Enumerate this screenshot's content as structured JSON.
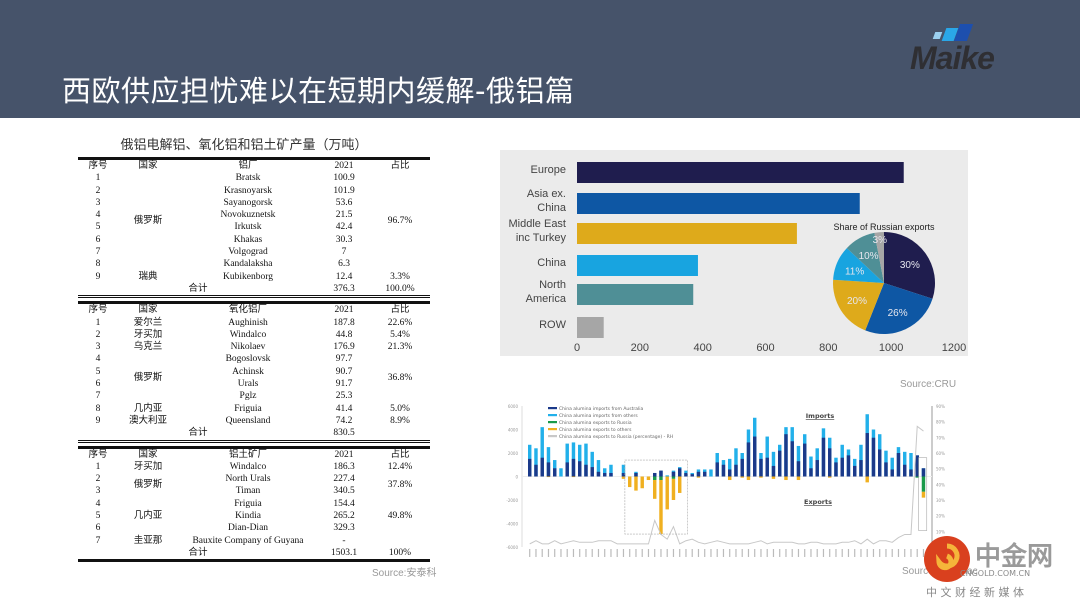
{
  "header": {
    "title": "西欧供应担忧难以在短期内缓解-俄铝篇",
    "logo_text": "Maike"
  },
  "tables": {
    "caption": "俄铝电解铝、氧化铝和铝土矿产量（万吨）",
    "source": "Source:安泰科",
    "sections": [
      {
        "headers": [
          "序号",
          "国家",
          "铝厂",
          "2021",
          "占比"
        ],
        "groups": [
          {
            "country": "俄罗斯",
            "share": "96.7%",
            "rows": [
              [
                "1",
                "Bratsk",
                "100.9"
              ],
              [
                "2",
                "Krasnoyarsk",
                "101.9"
              ],
              [
                "3",
                "Sayanogorsk",
                "53.6"
              ],
              [
                "4",
                "Novokuznetsk",
                "21.5"
              ],
              [
                "5",
                "Irkutsk",
                "42.4"
              ],
              [
                "6",
                "Khakas",
                "30.3"
              ],
              [
                "7",
                "Volgograd",
                "7"
              ],
              [
                "8",
                "Kandalaksha",
                "6.3"
              ]
            ]
          },
          {
            "country": "瑞典",
            "share": "3.3%",
            "rows": [
              [
                "9",
                "Kubikenborg",
                "12.4"
              ]
            ]
          }
        ],
        "total": {
          "label": "合计",
          "value": "376.3",
          "share": "100.0%"
        }
      },
      {
        "headers": [
          "序号",
          "国家",
          "氧化铝厂",
          "2021",
          "占比"
        ],
        "groups": [
          {
            "country": "爱尔兰",
            "share": "22.6%",
            "rows": [
              [
                "1",
                "Aughinish",
                "187.8"
              ]
            ]
          },
          {
            "country": "牙买加",
            "share": "5.4%",
            "rows": [
              [
                "2",
                "Windalco",
                "44.8"
              ]
            ]
          },
          {
            "country": "乌克兰",
            "share": "21.3%",
            "rows": [
              [
                "3",
                "Nikolaev",
                "176.9"
              ]
            ]
          },
          {
            "country": "俄罗斯",
            "share": "36.8%",
            "rows": [
              [
                "4",
                "Bogoslovsk",
                "97.7"
              ],
              [
                "5",
                "Achinsk",
                "90.7"
              ],
              [
                "6",
                "Urals",
                "91.7"
              ],
              [
                "7",
                "Pglz",
                "25.3"
              ]
            ]
          },
          {
            "country": "几内亚",
            "share": "5.0%",
            "rows": [
              [
                "8",
                "Friguia",
                "41.4"
              ]
            ]
          },
          {
            "country": "澳大利亚",
            "share": "8.9%",
            "rows": [
              [
                "9",
                "Queensland",
                "74.2"
              ]
            ]
          }
        ],
        "total": {
          "label": "合计",
          "value": "830.5",
          "share": ""
        }
      },
      {
        "headers": [
          "序号",
          "国家",
          "铝土矿厂",
          "2021",
          "占比"
        ],
        "groups": [
          {
            "country": "牙买加",
            "share": "12.4%",
            "rows": [
              [
                "1",
                "Windalco",
                "186.3"
              ]
            ]
          },
          {
            "country": "俄罗斯",
            "share": "37.8%",
            "rows": [
              [
                "2",
                "North Urals",
                "227.4"
              ],
              [
                "3",
                "Timan",
                "340.5"
              ]
            ]
          },
          {
            "country": "几内亚",
            "share": "49.8%",
            "rows": [
              [
                "4",
                "Friguia",
                "154.4"
              ],
              [
                "5",
                "Kindia",
                "265.2"
              ],
              [
                "6",
                "Dian-Dian",
                "329.3"
              ]
            ]
          },
          {
            "country": "圭亚那",
            "share": "",
            "rows": [
              [
                "7",
                "Bauxite Company of Guyana",
                "-"
              ]
            ]
          }
        ],
        "total": {
          "label": "合计",
          "value": "1503.1",
          "share": "100%"
        }
      }
    ]
  },
  "chart_data": [
    {
      "type": "bar",
      "orientation": "horizontal",
      "categories": [
        "Europe",
        "Asia ex. China",
        "Middle East inc Turkey",
        "China",
        "North America",
        "ROW"
      ],
      "values": [
        1040,
        900,
        700,
        385,
        370,
        85
      ],
      "colors": [
        "#1f1d4e",
        "#0e57a4",
        "#deaa1b",
        "#18a4e0",
        "#4f8f96",
        "#a6a6a6"
      ],
      "xlim": [
        0,
        1200
      ],
      "xticks": [
        0,
        200,
        400,
        600,
        800,
        1000,
        1200
      ],
      "source": "Source:CRU",
      "inset": {
        "type": "pie",
        "title": "Share of Russian exports",
        "labels": [
          "30%",
          "26%",
          "20%",
          "11%",
          "10%",
          "3%"
        ],
        "values": [
          30,
          26,
          20,
          11,
          10,
          3
        ]
      }
    },
    {
      "type": "bar",
      "stacked": true,
      "legend": [
        "China alumina imports from Australia",
        "China alumina imports from others",
        "China alumina exports to Russia",
        "China alumina exports to others",
        "China alumina exports to Russia (percentage) - RH"
      ],
      "colors": [
        "#1b3a8a",
        "#22b0ea",
        "#1a9a4a",
        "#f0b020",
        "#c8c8c8"
      ],
      "annotations": [
        "Imports",
        "Exports"
      ],
      "ylim": [
        -6000,
        6000
      ],
      "yticks": [
        "6000",
        "4000",
        "2000",
        "0",
        "-2000",
        "-4000",
        "-6000"
      ],
      "y2lim": [
        0,
        90
      ],
      "y2ticks": [
        "90%",
        "80%",
        "70%",
        "60%",
        "50%",
        "40%",
        "30%",
        "20%",
        "10%"
      ],
      "au": [
        1500,
        1000,
        1600,
        1200,
        700,
        0,
        1200,
        1500,
        1300,
        1000,
        800,
        400,
        300,
        300,
        0,
        300,
        0,
        300,
        0,
        0,
        300,
        500,
        0,
        400,
        700,
        300,
        200,
        400,
        400,
        0,
        1200,
        1000,
        600,
        1000,
        1500,
        2900,
        3400,
        1500,
        1600,
        900,
        2200,
        3600,
        3000,
        1300,
        2800,
        700,
        1400,
        3300,
        2400,
        1200,
        1600,
        1800,
        900,
        1400,
        3700,
        3300,
        2300,
        1200,
        600,
        2000,
        1000,
        600,
        1800,
        700
      ],
      "total_imports": [
        2700,
        2400,
        4200,
        2500,
        1400,
        700,
        2800,
        2900,
        2700,
        2800,
        2100,
        1400,
        700,
        1000,
        0,
        1000,
        0,
        400,
        0,
        0,
        300,
        500,
        100,
        500,
        800,
        500,
        300,
        600,
        600,
        600,
        2000,
        1400,
        1500,
        2400,
        2000,
        4000,
        5000,
        2000,
        3400,
        2100,
        2700,
        4200,
        4200,
        2600,
        3600,
        1700,
        2400,
        4100,
        3300,
        1600,
        2700,
        2300,
        1500,
        2700,
        5300,
        4000,
        3600,
        2200,
        1600,
        2500,
        2100,
        2000,
        1800,
        700
      ],
      "exp_russia": [
        0,
        0,
        0,
        0,
        0,
        0,
        0,
        0,
        0,
        0,
        0,
        0,
        0,
        0,
        0,
        0,
        0,
        0,
        0,
        0,
        -300,
        -300,
        0,
        -200,
        0,
        0,
        0,
        0,
        0,
        0,
        0,
        0,
        0,
        0,
        0,
        0,
        0,
        0,
        0,
        0,
        0,
        0,
        0,
        0,
        0,
        0,
        0,
        0,
        0,
        0,
        0,
        0,
        0,
        0,
        0,
        0,
        0,
        0,
        0,
        0,
        0,
        0,
        -100,
        -1300
      ],
      "exp_others": [
        0,
        0,
        0,
        -50,
        0,
        0,
        0,
        -50,
        0,
        0,
        0,
        0,
        0,
        0,
        0,
        -200,
        -900,
        -1200,
        -1000,
        -300,
        -1600,
        -4600,
        -2800,
        -1800,
        -1400,
        0,
        0,
        -100,
        0,
        0,
        0,
        0,
        -300,
        0,
        -100,
        -300,
        0,
        -100,
        0,
        -200,
        0,
        -300,
        0,
        -300,
        0,
        0,
        0,
        0,
        -100,
        0,
        0,
        0,
        0,
        0,
        -500,
        0,
        0,
        0,
        0,
        0,
        0,
        0,
        0,
        -500
      ],
      "pct": [
        2,
        4,
        2,
        2,
        4,
        2,
        3,
        4,
        3,
        3,
        3,
        4,
        4,
        4,
        2,
        2,
        2,
        2,
        2,
        2,
        17,
        8,
        5,
        13,
        2,
        4,
        5,
        3,
        2,
        3,
        4,
        3,
        2,
        2,
        2,
        2,
        3,
        4,
        2,
        3,
        3,
        3,
        3,
        2,
        2,
        3,
        3,
        2,
        2,
        2,
        3,
        3,
        4,
        2,
        5,
        2,
        4,
        4,
        3,
        6,
        8,
        8,
        77,
        74
      ],
      "source": "Source: Aladmac"
    }
  ],
  "watermark": {
    "name": "中金网",
    "url": "CNGOLD.COM.CN",
    "tagline": "中 文 财 经 新 媒 体"
  }
}
